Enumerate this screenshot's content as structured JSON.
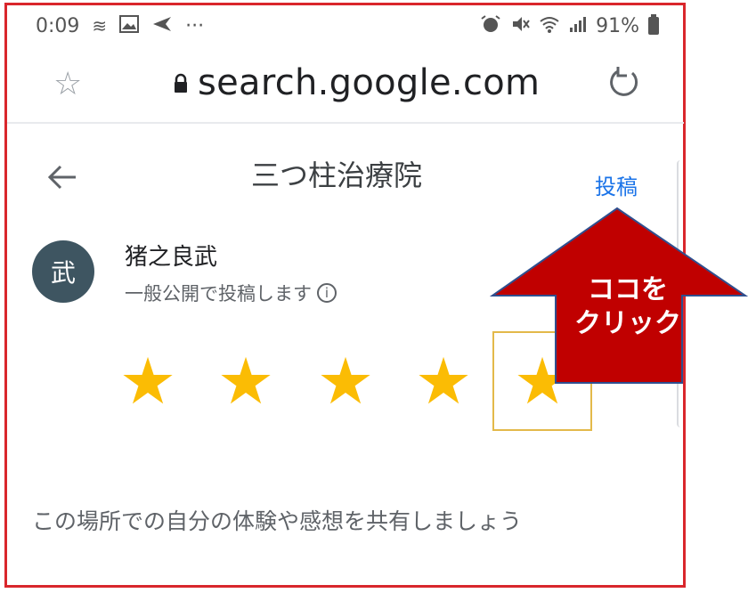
{
  "status_bar": {
    "time": "0:09",
    "more": "···",
    "battery": "91%"
  },
  "browser": {
    "url": "search.google.com"
  },
  "header": {
    "title": "三つ柱治療院",
    "post_label": "投稿"
  },
  "user": {
    "avatar_char": "武",
    "name": "猪之良武",
    "visibility_note": "一般公開で投稿します"
  },
  "rating": {
    "star_glyph": "★",
    "selected": 5
  },
  "review": {
    "placeholder": "この場所での自分の体験や感想を共有しましょう"
  },
  "callout": {
    "line1": "ココを",
    "line2": "クリック",
    "color": "#c00000"
  },
  "colors": {
    "accent": "#1a73e8",
    "star": "#fbbc04",
    "frame": "#d9262c"
  }
}
